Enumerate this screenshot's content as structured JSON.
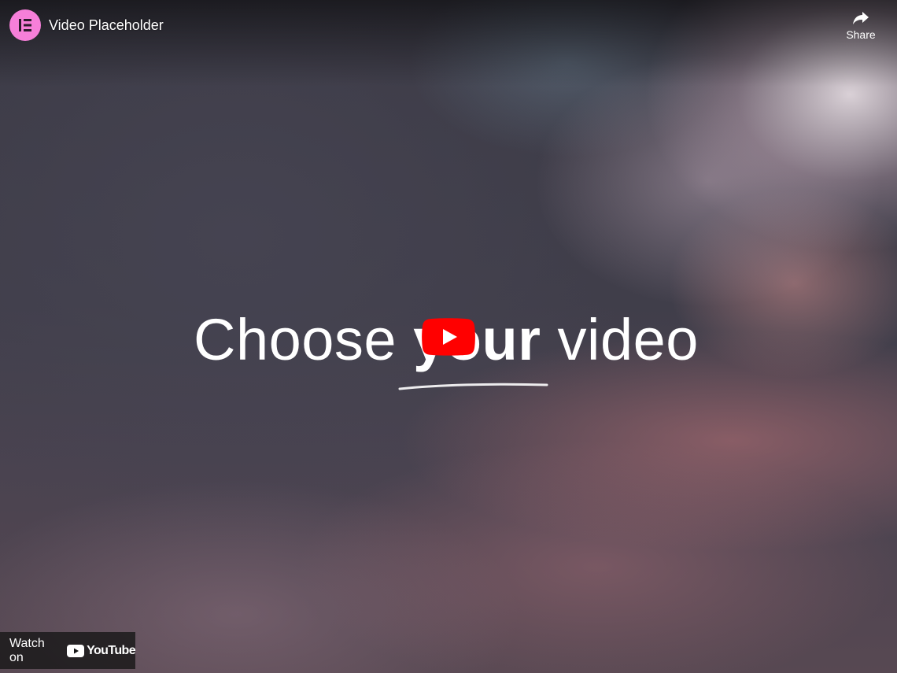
{
  "video": {
    "title": "Video Placeholder",
    "headline_part1": "Choose ",
    "headline_emphasis": "your",
    "headline_part2": " video"
  },
  "controls": {
    "share_label": "Share",
    "watch_on_label": "Watch on",
    "youtube_wordmark": "YouTube"
  },
  "icons": {
    "channel_avatar": "elementor-logo-icon",
    "share": "share-arrow-icon",
    "play": "youtube-play-icon",
    "youtube_logo": "youtube-logo-icon"
  },
  "colors": {
    "avatar_bg": "#f67fd9",
    "play_red": "#ff0000",
    "text": "#ffffff"
  }
}
